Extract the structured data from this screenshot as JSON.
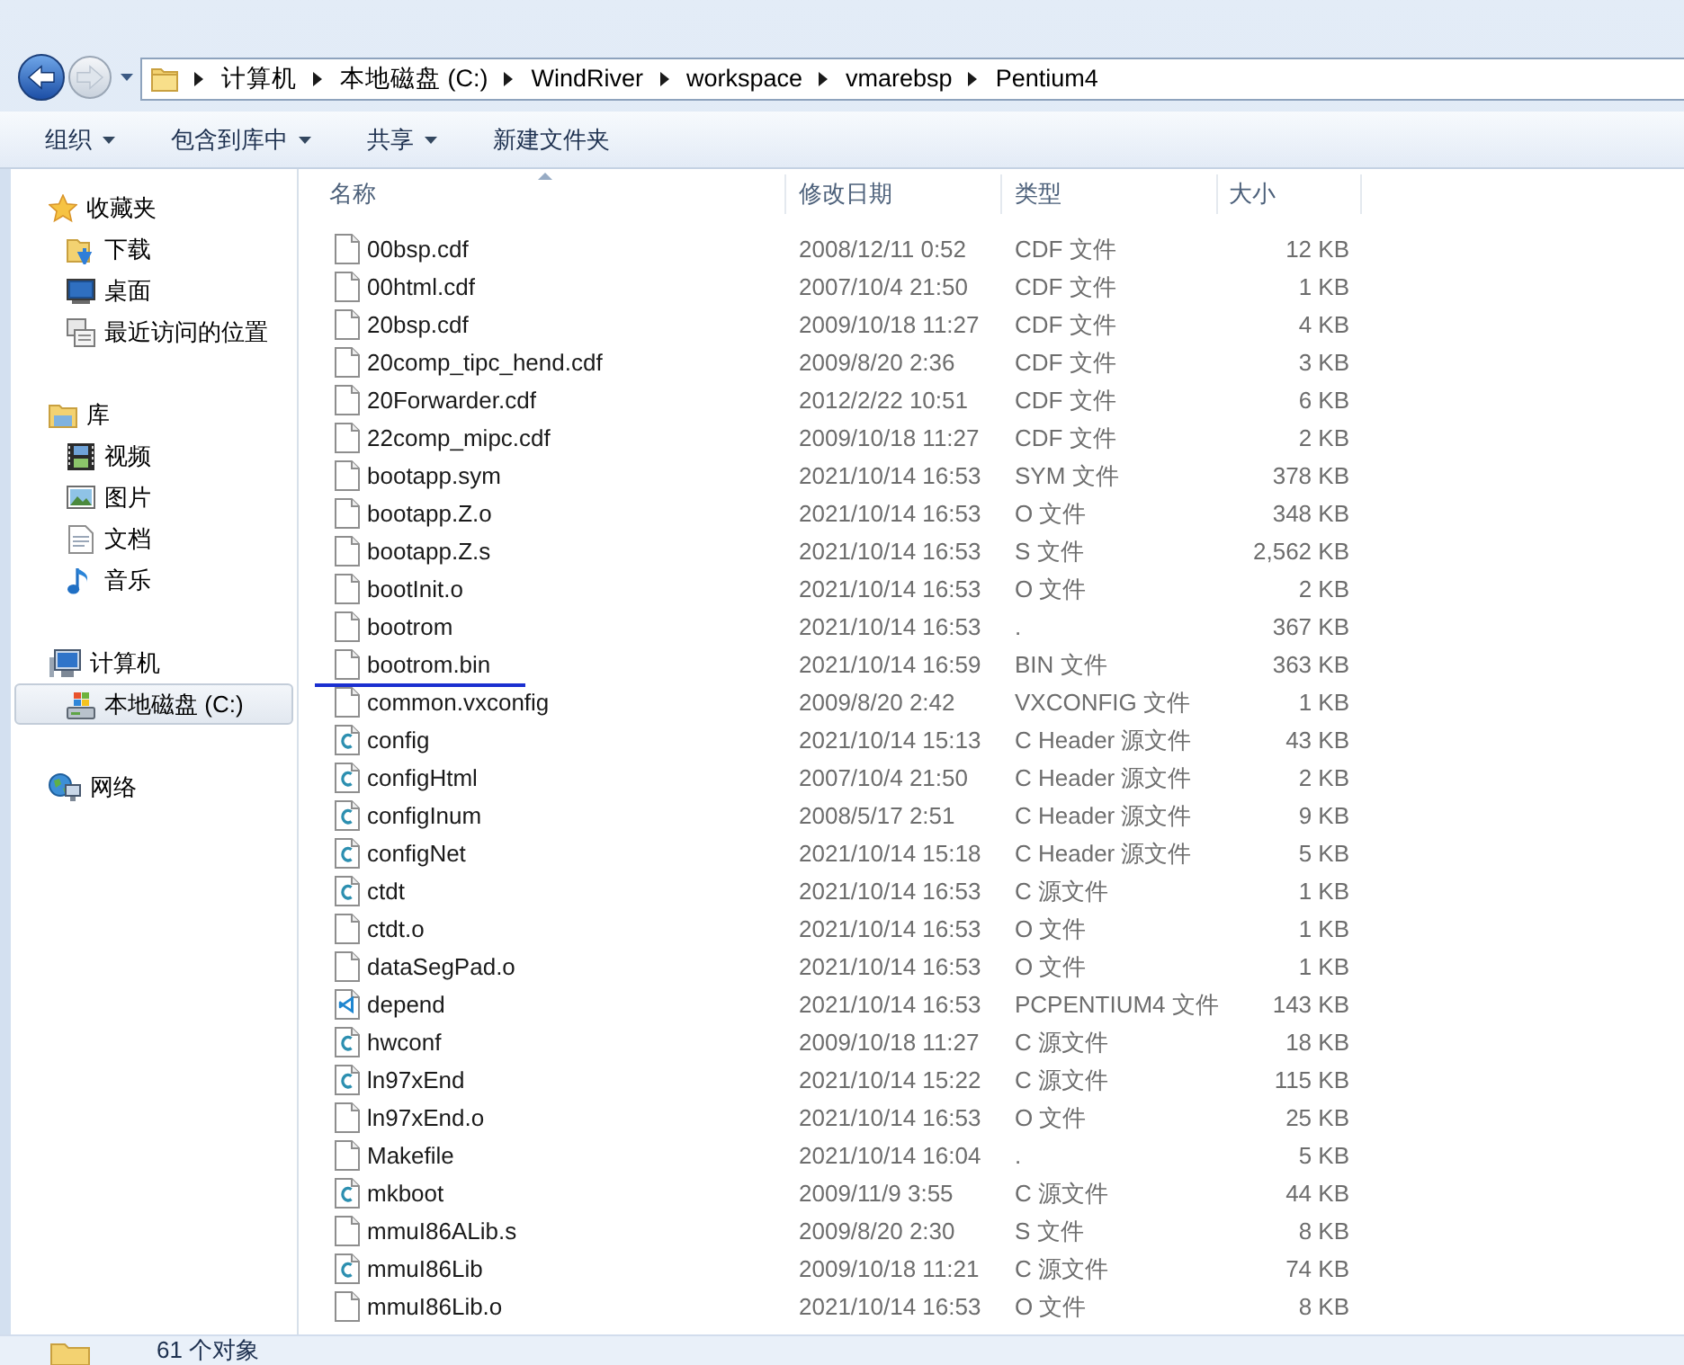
{
  "navigation": {
    "buttons": [
      {
        "kind": "back",
        "disabled": false
      },
      {
        "kind": "forward",
        "disabled": true
      }
    ]
  },
  "address_bar": {
    "path": [
      "计算机",
      "本地磁盘 (C:)",
      "WindRiver",
      "workspace",
      "vmarebsp",
      "Pentium4"
    ]
  },
  "toolbar": {
    "items": [
      {
        "label": "组织",
        "dropdown": true
      },
      {
        "label": "包含到库中",
        "dropdown": true
      },
      {
        "label": "共享",
        "dropdown": true
      },
      {
        "label": "新建文件夹",
        "dropdown": false
      }
    ]
  },
  "sidebar": {
    "groups": [
      {
        "label": "收藏夹",
        "selected": false,
        "children": [
          {
            "label": "下载",
            "selected": false
          },
          {
            "label": "桌面",
            "selected": false
          },
          {
            "label": "最近访问的位置",
            "selected": false
          }
        ]
      },
      {
        "label": "库",
        "selected": false,
        "children": [
          {
            "label": "视频",
            "selected": false
          },
          {
            "label": "图片",
            "selected": false
          },
          {
            "label": "文档",
            "selected": false
          },
          {
            "label": "音乐",
            "selected": false
          }
        ]
      },
      {
        "label": "计算机",
        "selected": false,
        "children": [
          {
            "label": "本地磁盘 (C:)",
            "selected": true
          }
        ]
      },
      {
        "label": "网络",
        "selected": false
      }
    ]
  },
  "file_list": {
    "columns": [
      {
        "label": "名称",
        "sorted": true
      },
      {
        "label": "修改日期",
        "sorted": false
      },
      {
        "label": "类型",
        "sorted": false
      },
      {
        "label": "大小",
        "sorted": false
      }
    ],
    "rows": [
      {
        "kind": "file",
        "name": "00bsp.cdf",
        "modified": "2008/12/11 0:52",
        "type": "CDF 文件",
        "size": "12 KB",
        "underlined": false
      },
      {
        "kind": "file",
        "name": "00html.cdf",
        "modified": "2007/10/4 21:50",
        "type": "CDF 文件",
        "size": "1 KB",
        "underlined": false
      },
      {
        "kind": "file",
        "name": "20bsp.cdf",
        "modified": "2009/10/18 11:27",
        "type": "CDF 文件",
        "size": "4 KB",
        "underlined": false
      },
      {
        "kind": "file",
        "name": "20comp_tipc_hend.cdf",
        "modified": "2009/8/20 2:36",
        "type": "CDF 文件",
        "size": "3 KB",
        "underlined": false
      },
      {
        "kind": "file",
        "name": "20Forwarder.cdf",
        "modified": "2012/2/22 10:51",
        "type": "CDF 文件",
        "size": "6 KB",
        "underlined": false
      },
      {
        "kind": "file",
        "name": "22comp_mipc.cdf",
        "modified": "2009/10/18 11:27",
        "type": "CDF 文件",
        "size": "2 KB",
        "underlined": false
      },
      {
        "kind": "file",
        "name": "bootapp.sym",
        "modified": "2021/10/14 16:53",
        "type": "SYM 文件",
        "size": "378 KB",
        "underlined": false
      },
      {
        "kind": "file",
        "name": "bootapp.Z.o",
        "modified": "2021/10/14 16:53",
        "type": "O 文件",
        "size": "348 KB",
        "underlined": false
      },
      {
        "kind": "file",
        "name": "bootapp.Z.s",
        "modified": "2021/10/14 16:53",
        "type": "S 文件",
        "size": "2,562 KB",
        "underlined": false
      },
      {
        "kind": "file",
        "name": "bootInit.o",
        "modified": "2021/10/14 16:53",
        "type": "O 文件",
        "size": "2 KB",
        "underlined": false
      },
      {
        "kind": "file",
        "name": "bootrom",
        "modified": "2021/10/14 16:53",
        "type": ".",
        "size": "367 KB",
        "underlined": false
      },
      {
        "kind": "file",
        "name": "bootrom.bin",
        "modified": "2021/10/14 16:59",
        "type": "BIN 文件",
        "size": "363 KB",
        "underlined": true
      },
      {
        "kind": "file",
        "name": "common.vxconfig",
        "modified": "2009/8/20 2:42",
        "type": "VXCONFIG 文件",
        "size": "1 KB",
        "underlined": false
      },
      {
        "kind": "c_source",
        "name": "config",
        "modified": "2021/10/14 15:13",
        "type": "C Header 源文件",
        "size": "43 KB",
        "underlined": false
      },
      {
        "kind": "c_source",
        "name": "configHtml",
        "modified": "2007/10/4 21:50",
        "type": "C Header 源文件",
        "size": "2 KB",
        "underlined": false
      },
      {
        "kind": "c_source",
        "name": "configInum",
        "modified": "2008/5/17 2:51",
        "type": "C Header 源文件",
        "size": "9 KB",
        "underlined": false
      },
      {
        "kind": "c_source",
        "name": "configNet",
        "modified": "2021/10/14 15:18",
        "type": "C Header 源文件",
        "size": "5 KB",
        "underlined": false
      },
      {
        "kind": "c_source",
        "name": "ctdt",
        "modified": "2021/10/14 16:53",
        "type": "C 源文件",
        "size": "1 KB",
        "underlined": false
      },
      {
        "kind": "file",
        "name": "ctdt.o",
        "modified": "2021/10/14 16:53",
        "type": "O 文件",
        "size": "1 KB",
        "underlined": false
      },
      {
        "kind": "file",
        "name": "dataSegPad.o",
        "modified": "2021/10/14 16:53",
        "type": "O 文件",
        "size": "1 KB",
        "underlined": false
      },
      {
        "kind": "editor",
        "name": "depend",
        "modified": "2021/10/14 16:53",
        "type": "PCPENTIUM4 文件",
        "size": "143 KB",
        "underlined": false
      },
      {
        "kind": "c_source",
        "name": "hwconf",
        "modified": "2009/10/18 11:27",
        "type": "C 源文件",
        "size": "18 KB",
        "underlined": false
      },
      {
        "kind": "c_source",
        "name": "ln97xEnd",
        "modified": "2021/10/14 15:22",
        "type": "C 源文件",
        "size": "115 KB",
        "underlined": false
      },
      {
        "kind": "file",
        "name": "ln97xEnd.o",
        "modified": "2021/10/14 16:53",
        "type": "O 文件",
        "size": "25 KB",
        "underlined": false
      },
      {
        "kind": "file",
        "name": "Makefile",
        "modified": "2021/10/14 16:04",
        "type": ".",
        "size": "5 KB",
        "underlined": false
      },
      {
        "kind": "c_source",
        "name": "mkboot",
        "modified": "2009/11/9 3:55",
        "type": "C 源文件",
        "size": "44 KB",
        "underlined": false
      },
      {
        "kind": "file",
        "name": "mmuI86ALib.s",
        "modified": "2009/8/20 2:30",
        "type": "S 文件",
        "size": "8 KB",
        "underlined": false
      },
      {
        "kind": "c_source",
        "name": "mmuI86Lib",
        "modified": "2009/10/18 11:21",
        "type": "C 源文件",
        "size": "74 KB",
        "underlined": false
      },
      {
        "kind": "file",
        "name": "mmuI86Lib.o",
        "modified": "2021/10/14 16:53",
        "type": "O 文件",
        "size": "8 KB",
        "underlined": false
      }
    ]
  },
  "status_bar": {
    "text": "61 个对象"
  }
}
